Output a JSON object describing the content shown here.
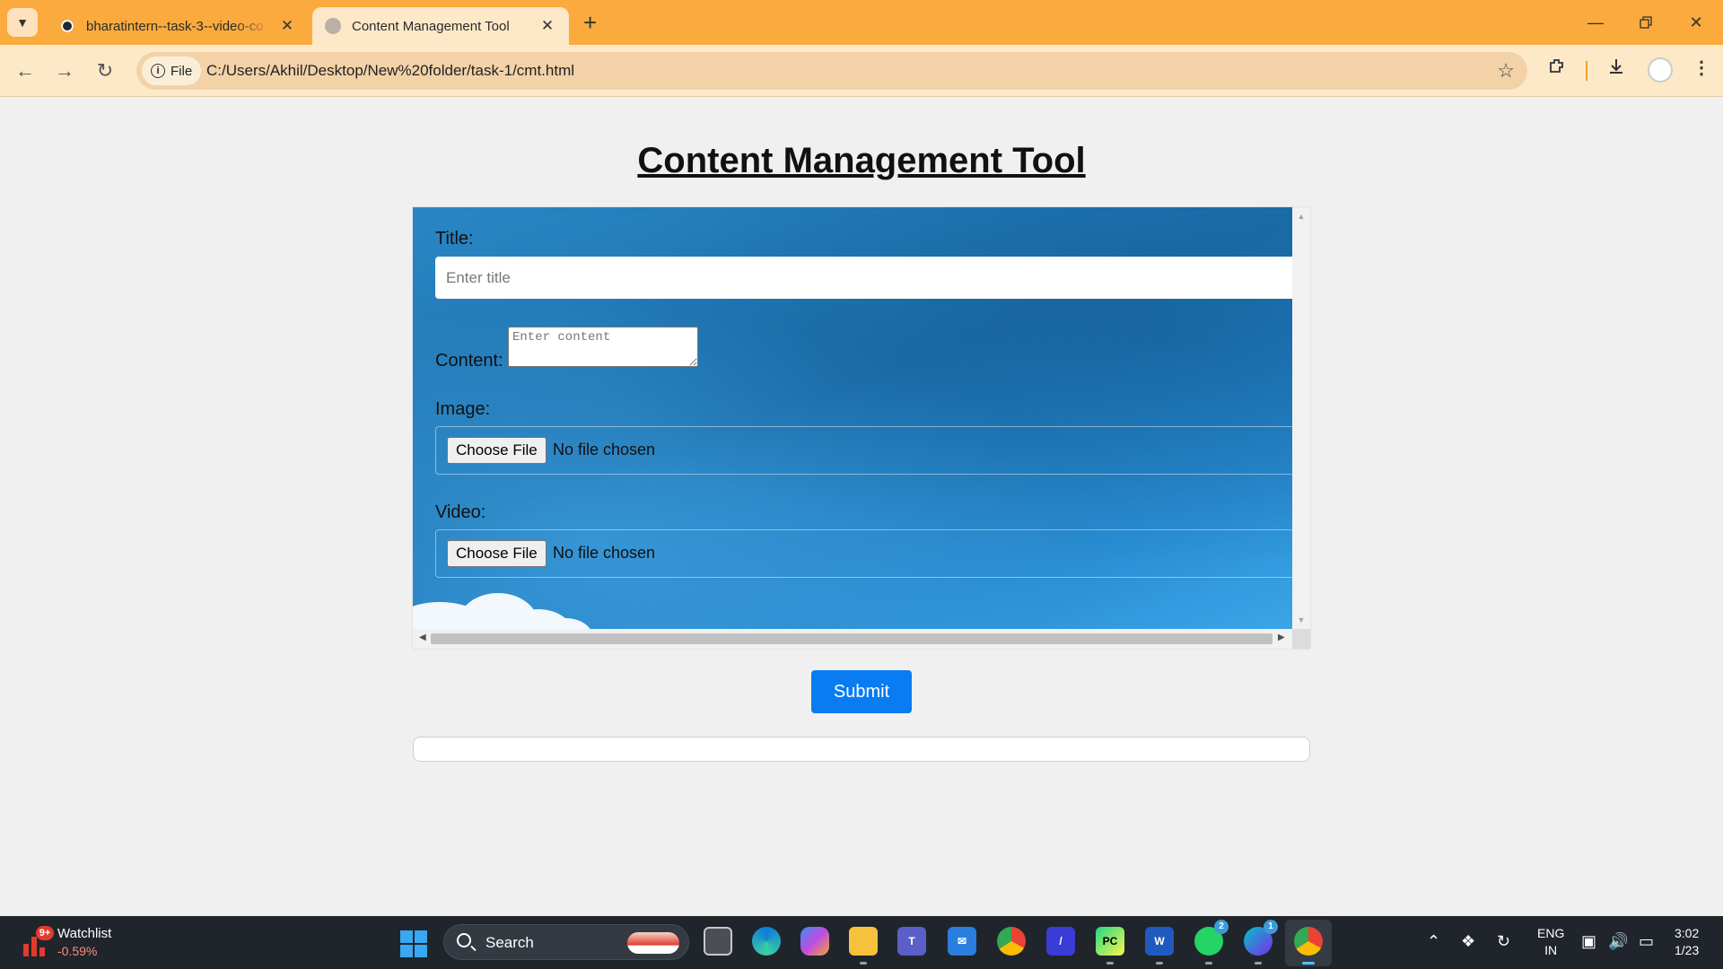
{
  "browser": {
    "tabs": [
      {
        "title": "bharatintern--task-3--video-co",
        "active": false
      },
      {
        "title": "Content Management Tool",
        "active": true
      }
    ],
    "address": {
      "chip_label": "File",
      "url": "C:/Users/Akhil/Desktop/New%20folder/task-1/cmt.html"
    }
  },
  "page": {
    "title": "Content Management Tool",
    "form": {
      "title_label": "Title:",
      "title_placeholder": "Enter title",
      "content_label": "Content:",
      "content_placeholder": "Enter content",
      "image_label": "Image:",
      "video_label": "Video:",
      "choose_file_label": "Choose File",
      "no_file_text": "No file chosen"
    },
    "submit_label": "Submit"
  },
  "taskbar": {
    "watchlist": {
      "badge": "9+",
      "name": "Watchlist",
      "change": "-0.59%"
    },
    "search_label": "Search",
    "apps": [
      "task-view",
      "edge",
      "copilot",
      "file-explorer",
      "teams",
      "mail",
      "chrome",
      "app",
      "pycharm",
      "word",
      "whatsapp",
      "canva",
      "chrome-active"
    ],
    "whatsapp_badge": "2",
    "canva_badge": "1",
    "lang_top": "ENG",
    "lang_bottom": "IN",
    "time": "3:02",
    "date": "1/23"
  },
  "colors": {
    "tabbar": "#fbaa3e",
    "toolbar": "#fde8c8",
    "form_panel": "#1c6fab",
    "submit": "#0a7cf2",
    "taskbar": "#20252b"
  }
}
